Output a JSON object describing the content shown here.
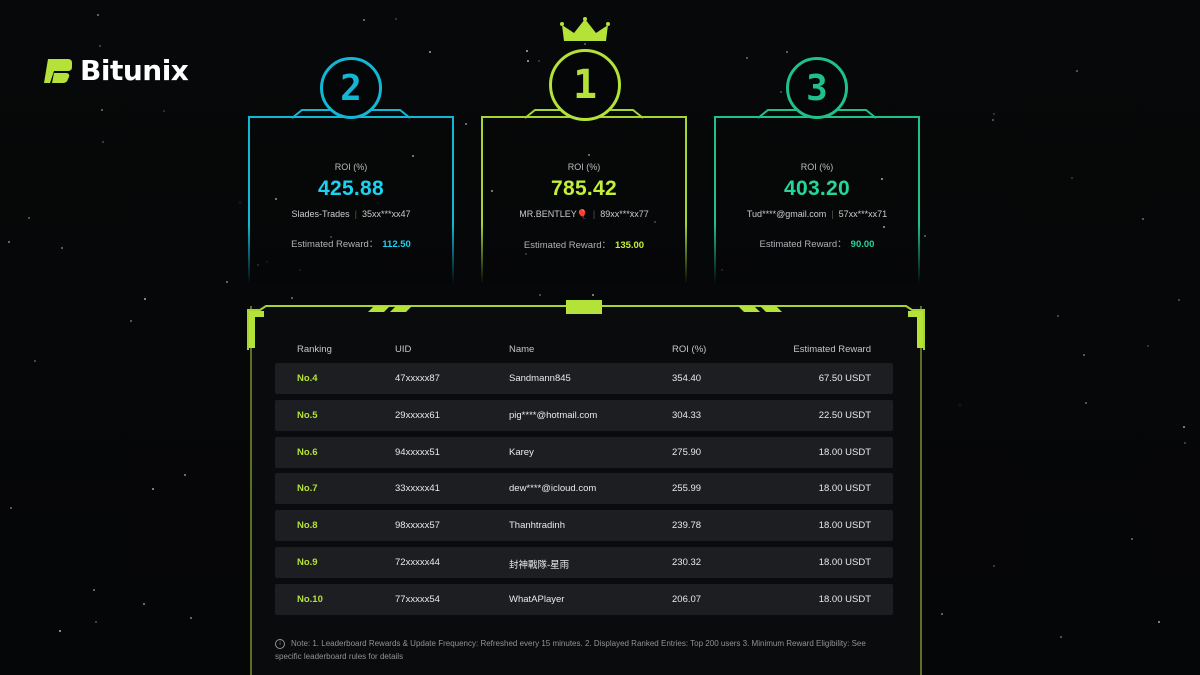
{
  "brand": {
    "name": "Bitunix"
  },
  "colors": {
    "rank1": "#a6d430",
    "rank2": "#13b7d6",
    "rank3": "#1fc08a",
    "accent": "#b4e238"
  },
  "podium": [
    {
      "rank": "2",
      "roi_label": "ROI (%)",
      "roi": "425.88",
      "name": "Slades-Trades",
      "uid": "35xx***xx47",
      "reward_label": "Estimated Reward：",
      "reward": "112.50"
    },
    {
      "rank": "1",
      "roi_label": "ROI (%)",
      "roi": "785.42",
      "name": "MR.BENTLEY🎈",
      "uid": "89xx***xx77",
      "reward_label": "Estimated Reward：",
      "reward": "135.00"
    },
    {
      "rank": "3",
      "roi_label": "ROI (%)",
      "roi": "403.20",
      "name": "Tud****@gmail.com",
      "uid": "57xx***xx71",
      "reward_label": "Estimated Reward：",
      "reward": "90.00"
    }
  ],
  "table": {
    "headers": {
      "ranking": "Ranking",
      "uid": "UID",
      "name": "Name",
      "roi": "ROI (%)",
      "reward": "Estimated Reward"
    },
    "rows": [
      {
        "rank": "No.4",
        "uid": "47xxxxx87",
        "name": "Sandmann845",
        "roi": "354.40",
        "reward": "67.50 USDT"
      },
      {
        "rank": "No.5",
        "uid": "29xxxxx61",
        "name": "pig****@hotmail.com",
        "roi": "304.33",
        "reward": "22.50 USDT"
      },
      {
        "rank": "No.6",
        "uid": "94xxxxx51",
        "name": "Karey",
        "roi": "275.90",
        "reward": "18.00 USDT"
      },
      {
        "rank": "No.7",
        "uid": "33xxxxx41",
        "name": "dew****@icloud.com",
        "roi": "255.99",
        "reward": "18.00 USDT"
      },
      {
        "rank": "No.8",
        "uid": "98xxxxx57",
        "name": "Thanhtradinh",
        "roi": "239.78",
        "reward": "18.00 USDT"
      },
      {
        "rank": "No.9",
        "uid": "72xxxxx44",
        "name": "封神戰隊-星雨",
        "roi": "230.32",
        "reward": "18.00 USDT"
      },
      {
        "rank": "No.10",
        "uid": "77xxxxx54",
        "name": "WhatAPlayer",
        "roi": "206.07",
        "reward": "18.00 USDT"
      }
    ]
  },
  "note": {
    "icon": "info-icon",
    "text": "Note: 1. Leaderboard Rewards & Update Frequency: Refreshed every 15 minutes. 2. Displayed Ranked Entries: Top 200 users 3. Minimum Reward Eligibility: See specific leaderboard rules for details"
  }
}
